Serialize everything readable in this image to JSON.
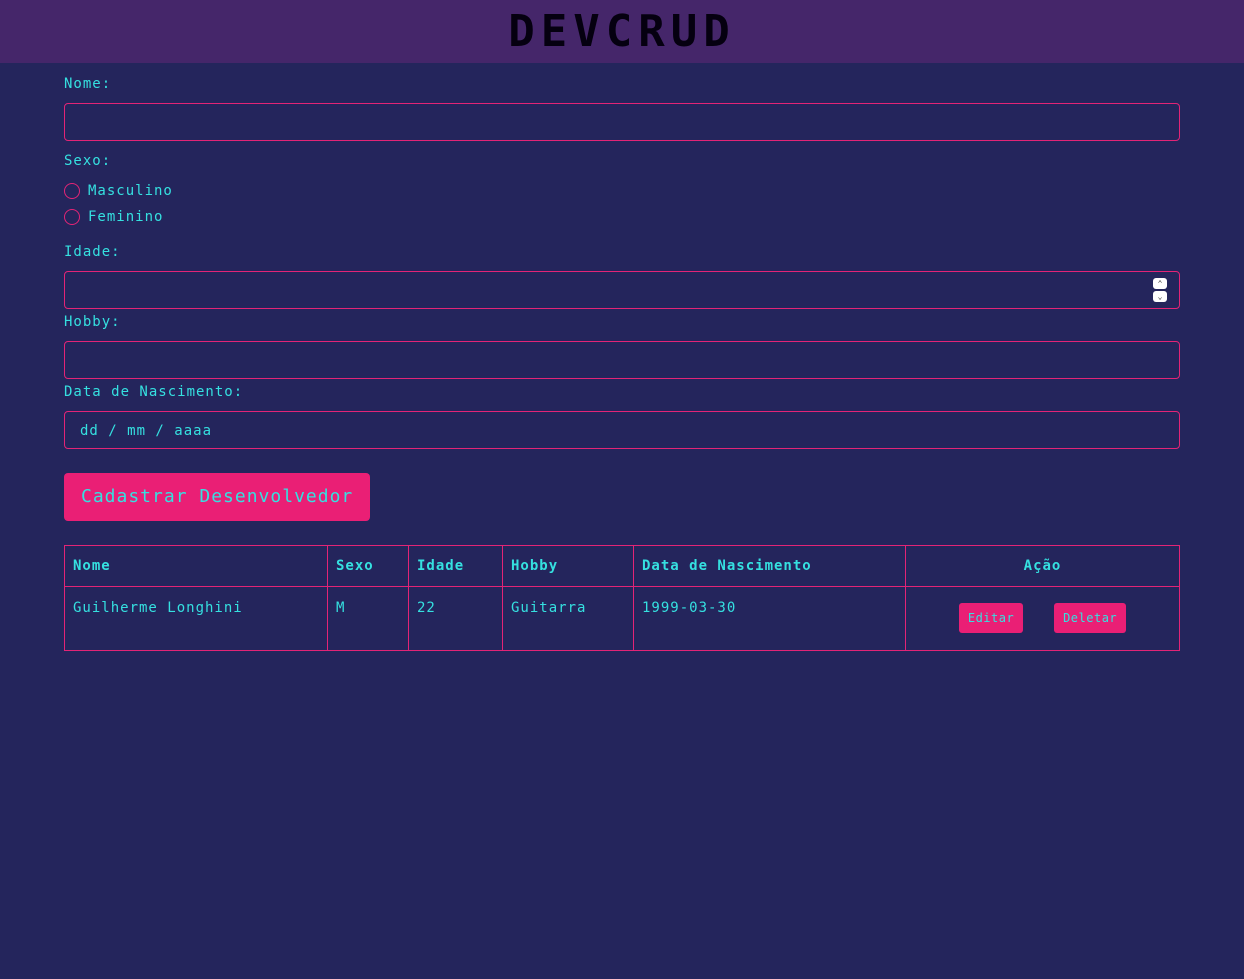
{
  "header": {
    "title": "DEVCRUD"
  },
  "form": {
    "nome_label": "Nome:",
    "sexo_label": "Sexo:",
    "sexo_options": [
      "Masculino",
      "Feminino"
    ],
    "idade_label": "Idade:",
    "hobby_label": "Hobby:",
    "nascimento_label": "Data de Nascimento:",
    "nascimento_placeholder": "dd / mm / aaaa",
    "submit_label": "Cadastrar Desenvolvedor"
  },
  "table": {
    "headers": [
      "Nome",
      "Sexo",
      "Idade",
      "Hobby",
      "Data de Nascimento",
      "Ação"
    ],
    "rows": [
      {
        "nome": "Guilherme Longhini",
        "sexo": "M",
        "idade": "22",
        "hobby": "Guitarra",
        "nascimento": "1999-03-30",
        "edit_label": "Editar",
        "delete_label": "Deletar"
      }
    ]
  },
  "colors": {
    "background": "#24255c",
    "header": "#45266a",
    "accent": "#ea1f75",
    "text": "#35e0e0"
  }
}
